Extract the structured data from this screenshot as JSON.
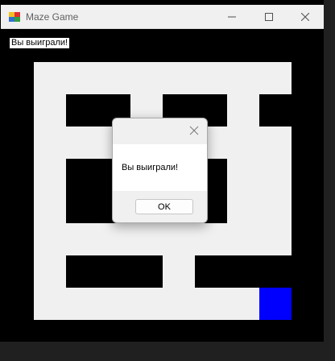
{
  "window": {
    "title": "Maze Game",
    "icon": "app-icon"
  },
  "status_label": "Вы выиграли!",
  "maze": {
    "rows": 8,
    "cols": 8,
    "colors": {
      "wall": "#000000",
      "path": "#f0f0f0",
      "player": "#0000ff"
    },
    "grid": [
      [
        0,
        0,
        0,
        0,
        0,
        0,
        0,
        0
      ],
      [
        0,
        1,
        1,
        0,
        1,
        1,
        0,
        1
      ],
      [
        0,
        0,
        0,
        0,
        0,
        0,
        0,
        0
      ],
      [
        0,
        1,
        1,
        0,
        0,
        1,
        0,
        0
      ],
      [
        0,
        1,
        1,
        0,
        0,
        1,
        0,
        0
      ],
      [
        0,
        0,
        0,
        0,
        0,
        0,
        0,
        0
      ],
      [
        0,
        1,
        1,
        1,
        0,
        1,
        1,
        1
      ],
      [
        0,
        0,
        0,
        0,
        0,
        0,
        0,
        0
      ]
    ],
    "player": {
      "row": 7,
      "col": 7
    }
  },
  "dialog": {
    "message": "Вы выиграли!",
    "ok_label": "OK"
  }
}
